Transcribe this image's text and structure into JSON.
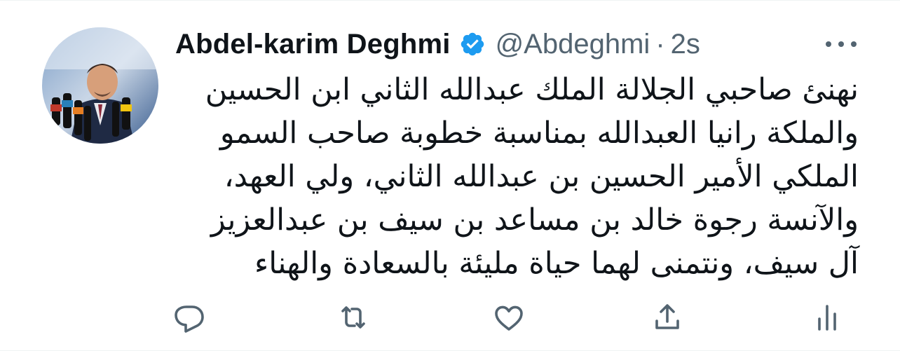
{
  "author": {
    "display_name": "Abdel-karim Deghmi",
    "handle": "@Abdeghmi",
    "separator": "·",
    "timestamp": "2s",
    "verified": true,
    "avatar_icon": "profile-photo-speaker-with-microphones"
  },
  "tweet": {
    "lines": [
      "نهنئ صاحبي الجلالة الملك عبدالله الثاني ابن الحسين",
      "والملكة رانيا العبدالله بمناسبة خطوبة صاحب السمو",
      "الملكي الأمير الحسين بن عبدالله الثاني، ولي العهد،",
      "والآنسة رجوة خالد بن مساعد بن سيف بن عبدالعزيز",
      "آل سيف، ونتمنى لهما حياة مليئة بالسعادة والهناء"
    ]
  },
  "actions": {
    "icons": [
      "reply-icon",
      "retweet-icon",
      "like-icon",
      "share-icon",
      "analytics-icon"
    ]
  },
  "colors": {
    "text": "#0f1419",
    "secondary": "#536471",
    "verified_blue": "#1d9bf0"
  }
}
